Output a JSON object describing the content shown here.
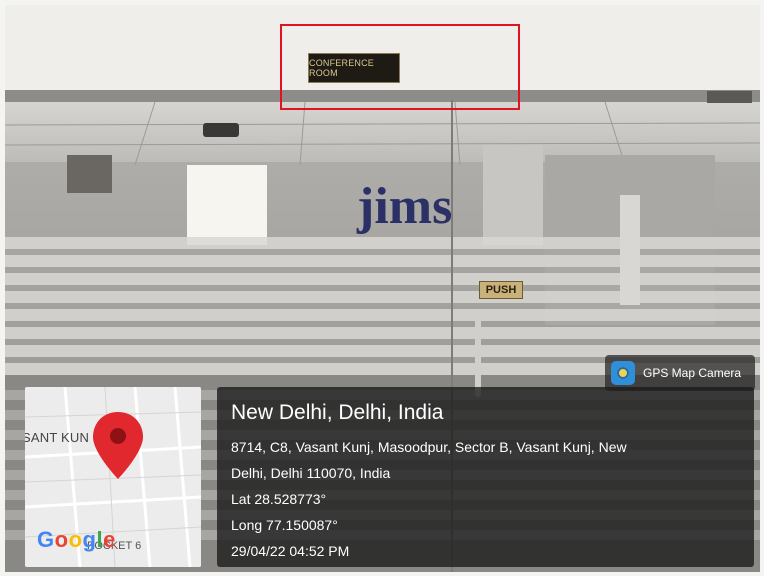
{
  "scene": {
    "door_sign": "CONFERENCE ROOM",
    "push_plate": "PUSH",
    "logo_text": "jims"
  },
  "badge": {
    "label": "GPS Map Camera",
    "icon": "gps-map-camera-icon"
  },
  "map": {
    "street_label": "SANT KUN",
    "pin_icon": "map-pin-icon",
    "google_letters": [
      "G",
      "o",
      "o",
      "g",
      "l",
      "e"
    ],
    "locality_label": "POCKET 6"
  },
  "location": {
    "title": "New Delhi, Delhi, India",
    "address_line1": "8714, C8, Vasant Kunj, Masoodpur, Sector B, Vasant Kunj, New",
    "address_line2": "Delhi, Delhi 110070, India",
    "lat": "Lat 28.528773°",
    "long": "Long 77.150087°",
    "datetime": "29/04/22 04:52 PM"
  },
  "colors": {
    "highlight": "#e0141e",
    "pin": "#e0282e"
  }
}
